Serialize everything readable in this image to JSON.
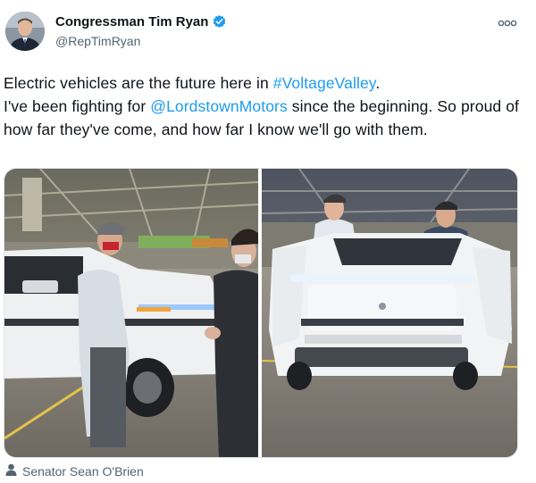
{
  "author": {
    "display_name": "Congressman Tim Ryan",
    "handle": "@RepTimRyan",
    "verified_icon": "verified-badge-icon",
    "more_icon": "more-options-icon"
  },
  "tweet": {
    "line1_prefix": "Electric vehicles are the future here in ",
    "hashtag": "#VoltageValley",
    "line1_suffix": ".",
    "line2_prefix": "I've been fighting for ",
    "mention": "@LordstownMotors",
    "line2_suffix": " since the beginning. So proud of how far they've come, and how far I know we'll go with them."
  },
  "media": {
    "photo_left_label": "truck-photo-left",
    "photo_right_label": "truck-photo-right"
  },
  "photo_tag": {
    "icon": "person-icon",
    "text": "Senator Sean O'Brien"
  },
  "colors": {
    "link": "#1d9bf0",
    "secondary_text": "#536471"
  }
}
